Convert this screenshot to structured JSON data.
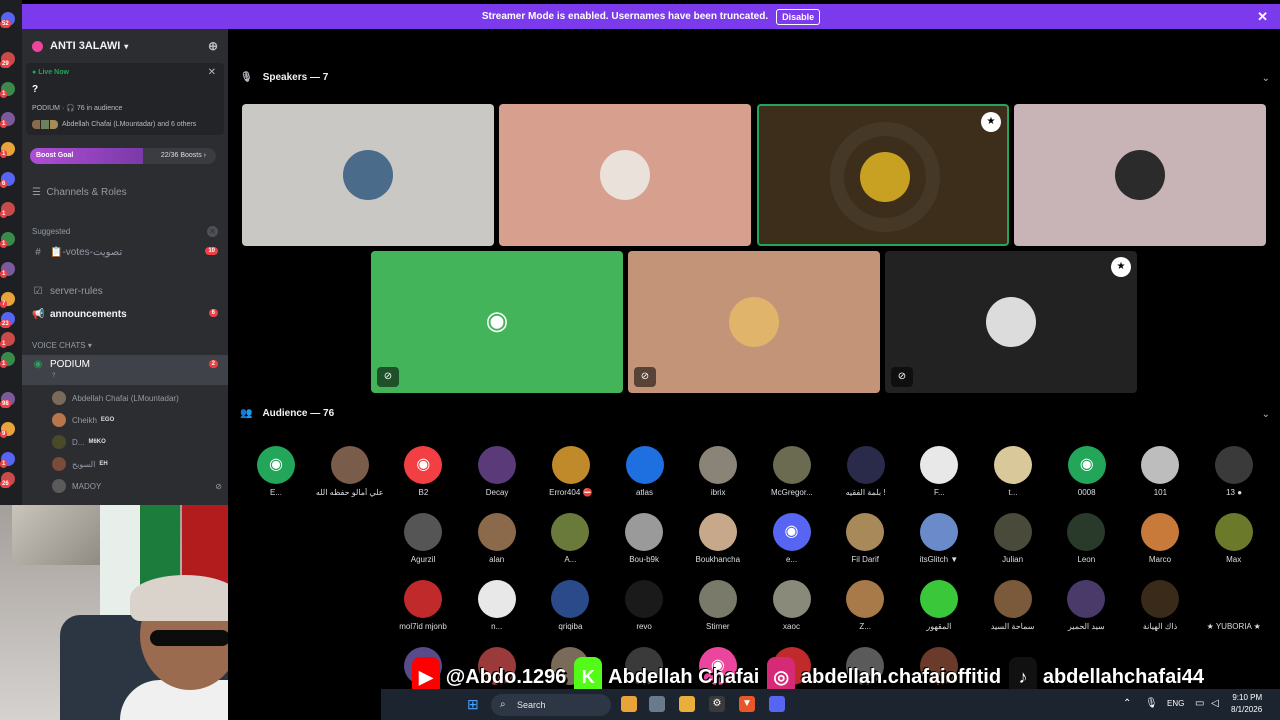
{
  "banner": {
    "text": "Streamer Mode is enabled. Usernames have been truncated.",
    "button": "Disable",
    "close": "✕"
  },
  "server": {
    "name": "ANTI 3ALAWI"
  },
  "rail_badges": [
    "52",
    "29",
    "1",
    "1",
    "1",
    "6",
    "1",
    "1",
    "1",
    "7",
    "23",
    "1",
    "1",
    "98",
    "9",
    "1",
    "26"
  ],
  "live": {
    "label": "Live Now",
    "title": "?",
    "info": "PODIUM · 🎧 76 in audience",
    "audience": "Abdellah Chafai (LMountadar) and 6 others"
  },
  "boost": {
    "label": "Boost Goal",
    "value": "22/36 Boosts ›",
    "progress": 0.61
  },
  "channels_roles": "Channels & Roles",
  "suggested": {
    "label": "Suggested",
    "channel": "📋-votes-تصويت",
    "badge": "10"
  },
  "channels": [
    {
      "name": "server-rules",
      "badge": ""
    },
    {
      "name": "announcements",
      "badge": "6"
    }
  ],
  "voice_section": "VOICE CHATS",
  "voice_channel": {
    "name": "PODIUM",
    "badge": "2",
    "sub": "?"
  },
  "voice_users": [
    {
      "name": "Abdellah Chafai (LMountadar)",
      "tag": ""
    },
    {
      "name": "Cheikh",
      "tag": "EGO"
    },
    {
      "name": "D...",
      "tag": "M6KO"
    },
    {
      "name": "السويح",
      "tag": "EH"
    },
    {
      "name": "MADOY",
      "tag": ""
    }
  ],
  "speakers_header": "Speakers — 7",
  "audience_header": "Audience — 76",
  "speakers": [
    {
      "bg": "#c9c8c4",
      "av": "#4a6b8a",
      "muted": false,
      "star": false,
      "speaking": false,
      "discord": false
    },
    {
      "bg": "#d79f8e",
      "av": "#e9e1da",
      "muted": false,
      "star": false,
      "speaking": false,
      "discord": false
    },
    {
      "bg": "#3d2e1c",
      "av": "#c9a122",
      "muted": false,
      "star": true,
      "speaking": true,
      "discord": false
    },
    {
      "bg": "#c8b3b6",
      "av": "#2b2b2b",
      "muted": false,
      "star": false,
      "speaking": false,
      "discord": false
    },
    {
      "bg": "#43b45a",
      "av": "#43b45a",
      "muted": true,
      "star": false,
      "speaking": false,
      "discord": true
    },
    {
      "bg": "#c49479",
      "av": "#e0b46a",
      "muted": true,
      "star": false,
      "speaking": false,
      "discord": false
    },
    {
      "bg": "#222222",
      "av": "#dcdcdc",
      "muted": true,
      "star": true,
      "speaking": false,
      "discord": false
    }
  ],
  "audience": [
    [
      {
        "name": "E...",
        "color": "#23a55a",
        "discord": true
      },
      {
        "name": "علي أمالو حفظه الله",
        "color": "#7a5c4a",
        "discord": false
      },
      {
        "name": "B2",
        "color": "#f23f43",
        "discord": true
      },
      {
        "name": "Decay",
        "color": "#5b3a7a",
        "discord": false
      },
      {
        "name": "Error404 ⛔",
        "color": "#c08a2a",
        "discord": false
      },
      {
        "name": "atlas",
        "color": "#1e6fe0",
        "discord": false
      },
      {
        "name": "ibrix",
        "color": "#8a8478",
        "discord": false
      },
      {
        "name": "McGregor...",
        "color": "#6b6b52",
        "discord": false
      },
      {
        "name": "بلمة الفقيه !",
        "color": "#2a2a4a",
        "discord": false
      },
      {
        "name": "F...",
        "color": "#e8e8e8",
        "discord": false
      },
      {
        "name": "t...",
        "color": "#d8c89a",
        "discord": false
      },
      {
        "name": "0008",
        "color": "#23a55a",
        "discord": true
      },
      {
        "name": "101",
        "color": "#bdbdbd",
        "discord": false
      },
      {
        "name": "13 ●",
        "color": "#3a3a3a",
        "discord": false
      }
    ],
    [
      {
        "name": "Agurzil",
        "color": "#555555",
        "discord": false
      },
      {
        "name": "alan",
        "color": "#8a6a4a",
        "discord": false
      },
      {
        "name": "A...",
        "color": "#6a7a3a",
        "discord": false
      },
      {
        "name": "Bou-b9k",
        "color": "#9a9a9a",
        "discord": false
      },
      {
        "name": "Boukhancha",
        "color": "#c8a88a",
        "discord": false
      },
      {
        "name": "e...",
        "color": "#5865f2",
        "discord": true
      },
      {
        "name": "Fil Darif",
        "color": "#a88a5a",
        "discord": false
      },
      {
        "name": "itsGlitch ▼",
        "color": "#6a8aca",
        "discord": false
      },
      {
        "name": "Julian",
        "color": "#4a4a3a",
        "discord": false
      },
      {
        "name": "Leon",
        "color": "#2a3a2a",
        "discord": false
      },
      {
        "name": "Marco",
        "color": "#c87a3a",
        "discord": false
      },
      {
        "name": "Max",
        "color": "#6a7a2a",
        "discord": false
      }
    ],
    [
      {
        "name": "mol7id mjonb",
        "color": "#c02a2a",
        "discord": false
      },
      {
        "name": "n...",
        "color": "#e8e8e8",
        "discord": false
      },
      {
        "name": "qriqiba",
        "color": "#2a4a8a",
        "discord": false
      },
      {
        "name": "revo",
        "color": "#1a1a1a",
        "discord": false
      },
      {
        "name": "Stirner",
        "color": "#7a7a6a",
        "discord": false
      },
      {
        "name": "xaoc",
        "color": "#8a8a7a",
        "discord": false
      },
      {
        "name": "Z...",
        "color": "#a87a4a",
        "discord": false
      },
      {
        "name": "المقهور",
        "color": "#3ac83a",
        "discord": false
      },
      {
        "name": "سماحة السيد",
        "color": "#7a5a3a",
        "discord": false
      },
      {
        "name": "سيد الحمير",
        "color": "#4a3a6a",
        "discord": false
      },
      {
        "name": "ذاك الهيانة",
        "color": "#3a2a1a",
        "discord": false
      },
      {
        "name": "★ YUBORIA ★",
        "color": "#000000",
        "discord": false
      }
    ],
    [
      {
        "name": "",
        "color": "#5a4a8a",
        "discord": false
      },
      {
        "name": "",
        "color": "#9a3a3a",
        "discord": false
      },
      {
        "name": "",
        "color": "#7a6a5a",
        "discord": false
      },
      {
        "name": "",
        "color": "#3a3a3a",
        "discord": false
      },
      {
        "name": "",
        "color": "#eb459e",
        "discord": true
      },
      {
        "name": "",
        "color": "#c02a2a",
        "discord": false
      },
      {
        "name": "",
        "color": "#5a5a5a",
        "discord": false
      },
      {
        "name": "",
        "color": "#6a3a2a",
        "discord": false
      }
    ]
  ],
  "social": [
    {
      "icon": "▶",
      "label": "@Abdo.1296",
      "color": "#ff0000"
    },
    {
      "icon": "K",
      "label": "Abdellah Chafai",
      "color": "#53fc18"
    },
    {
      "icon": "◎",
      "label": "abdellah.chafaioffitid",
      "color": "#d62976"
    },
    {
      "icon": "♪",
      "label": "abdellahchafai44",
      "color": "#111111"
    }
  ],
  "taskbar": {
    "search": "Search",
    "lang": "ENG",
    "time": "9:10 PM",
    "date": "8/1/2026"
  }
}
